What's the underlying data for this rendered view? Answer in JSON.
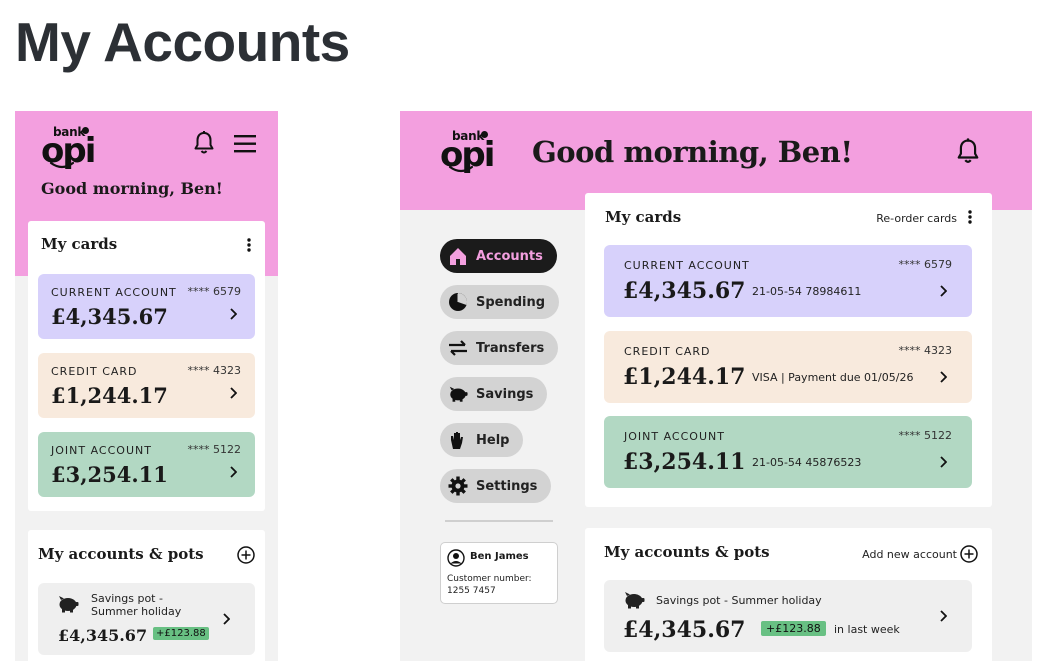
{
  "page": {
    "title": "My Accounts"
  },
  "brand": {
    "small": "bank",
    "name": "opi"
  },
  "colors": {
    "header_pink": "#f39fdf",
    "current_account": "#d7d1fb",
    "credit_card": "#f8eadd",
    "joint_account": "#b2d8c3",
    "positive_badge": "#68c083",
    "nav_active": "#1b1b1b"
  },
  "mobile": {
    "greeting": "Good morning, Ben!",
    "icons": [
      "bell-icon",
      "hamburger-menu-icon"
    ],
    "cards_section": {
      "title": "My cards",
      "accounts": [
        {
          "type": "CURRENT ACCOUNT",
          "masked_number": "**** 6579",
          "balance": "£4,345.67"
        },
        {
          "type": "CREDIT CARD",
          "masked_number": "**** 4323",
          "balance": "£1,244.17"
        },
        {
          "type": "JOINT ACCOUNT",
          "masked_number": "**** 5122",
          "balance": "£3,254.11"
        }
      ]
    },
    "pots_section": {
      "title": "My accounts & pots",
      "pot": {
        "name": "Savings pot - Summer holiday",
        "balance": "£4,345.67",
        "change": "+£123.88"
      }
    }
  },
  "desktop": {
    "greeting": "Good morning, Ben!",
    "nav": [
      {
        "label": "Accounts",
        "icon": "home-icon",
        "active": true
      },
      {
        "label": "Spending",
        "icon": "pie-chart-icon",
        "active": false
      },
      {
        "label": "Transfers",
        "icon": "transfer-arrows-icon",
        "active": false
      },
      {
        "label": "Savings",
        "icon": "piggy-bank-icon",
        "active": false
      },
      {
        "label": "Help",
        "icon": "hand-icon",
        "active": false
      },
      {
        "label": "Settings",
        "icon": "gear-icon",
        "active": false
      }
    ],
    "profile": {
      "name": "Ben James",
      "customer_label": "Customer number:",
      "customer_number": "1255 7457"
    },
    "cards_section": {
      "title": "My cards",
      "action": "Re-order cards",
      "accounts": [
        {
          "type": "CURRENT ACCOUNT",
          "masked_number": "**** 6579",
          "balance": "£4,345.67",
          "detail": "21-05-54 78984611"
        },
        {
          "type": "CREDIT CARD",
          "masked_number": "**** 4323",
          "balance": "£1,244.17",
          "detail": "VISA | Payment due 01/05/26"
        },
        {
          "type": "JOINT ACCOUNT",
          "masked_number": "**** 5122",
          "balance": "£3,254.11",
          "detail": "21-05-54 45876523"
        }
      ]
    },
    "pots_section": {
      "title": "My accounts & pots",
      "action": "Add new account",
      "pot": {
        "name": "Savings pot - Summer holiday",
        "balance": "£4,345.67",
        "change": "+£123.88",
        "period": "in last week"
      }
    }
  }
}
